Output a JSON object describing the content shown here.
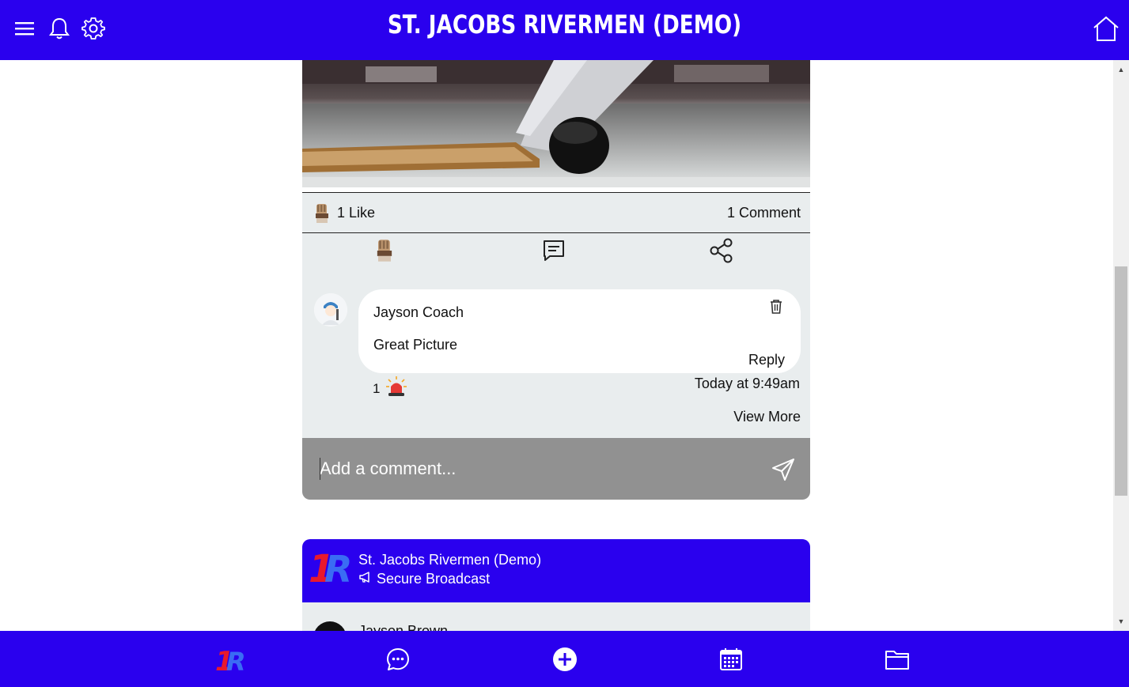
{
  "header": {
    "title": "ST. JACOBS RIVERMEN (DEMO)",
    "icons": [
      "menu-icon",
      "bell-icon",
      "gear-icon",
      "home-icon"
    ]
  },
  "post": {
    "likes_label": "1 Like",
    "comments_label": "1 Comment",
    "actions": [
      "glove-like-icon",
      "comment-icon",
      "share-icon"
    ],
    "comment": {
      "author": "Jayson Coach",
      "text": "Great Picture",
      "reply_label": "Reply",
      "reaction_count": "1",
      "reaction_icon": "siren-icon",
      "timestamp": "Today at 9:49am"
    },
    "view_more_label": "View More",
    "comment_input_placeholder": "Add a comment..."
  },
  "post2": {
    "team_name": "St. Jacobs Rivermen (Demo)",
    "broadcast_label": "Secure Broadcast",
    "author_partial": "Jayson Brown"
  },
  "bottom_nav": {
    "items": [
      "team-logo",
      "chat-icon",
      "add-icon",
      "calendar-icon",
      "folder-icon"
    ]
  },
  "colors": {
    "brand": "#2a00ee",
    "panel": "#e9edee",
    "input_bar": "#919191",
    "logo_red": "#e8192c"
  }
}
